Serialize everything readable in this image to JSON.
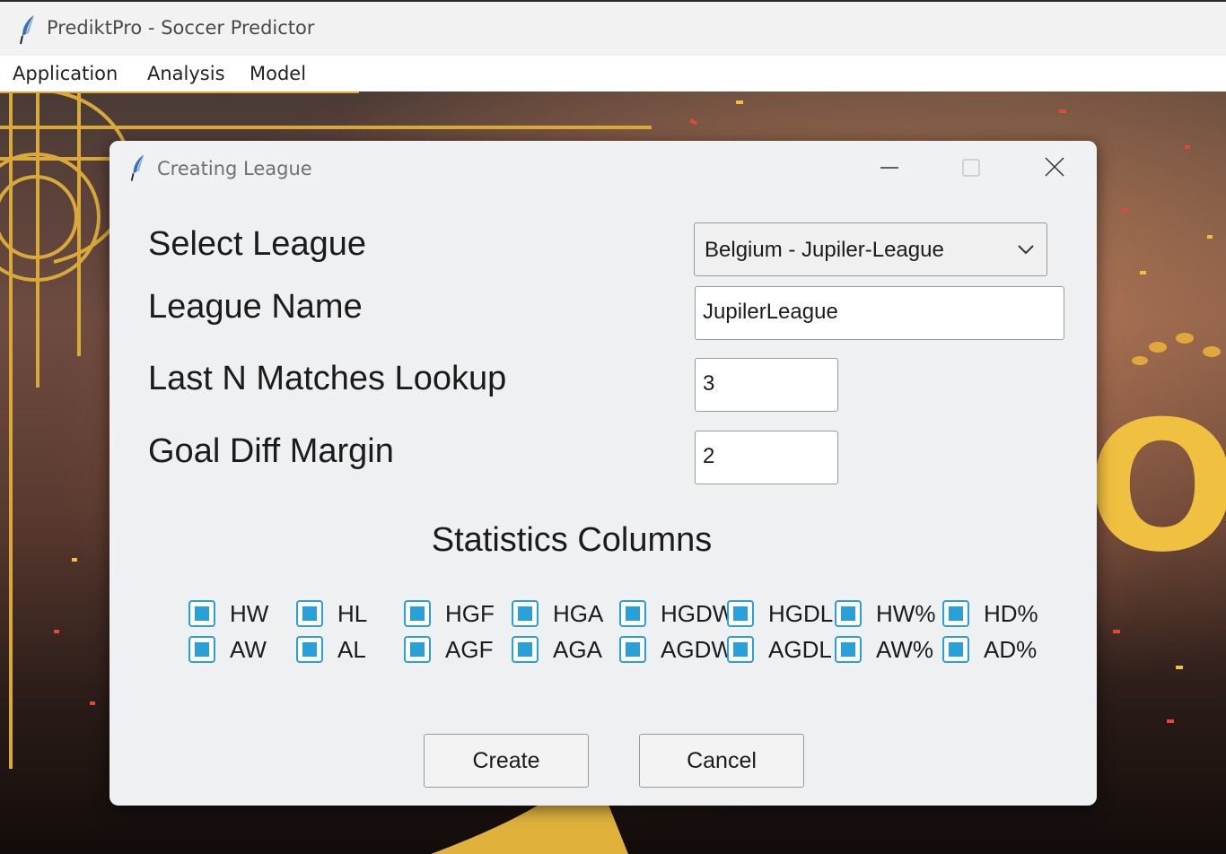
{
  "app": {
    "title": "PrediktPro - Soccer Predictor"
  },
  "menubar": [
    "Application",
    "Analysis",
    "Model"
  ],
  "dialog": {
    "title": "Creating League",
    "fields": {
      "select_league_label": "Select League",
      "select_league_value": "Belgium - Jupiler-League",
      "league_name_label": "League Name",
      "league_name_value": "JupilerLeague",
      "last_n_label": "Last N Matches Lookup",
      "last_n_value": "3",
      "goal_diff_label": "Goal Diff Margin",
      "goal_diff_value": "2"
    },
    "stats_title": "Statistics Columns",
    "stats_row1": [
      "HW",
      "HL",
      "HGF",
      "HGA",
      "HGDW",
      "HGDL",
      "HW%",
      "HD%"
    ],
    "stats_row2": [
      "AW",
      "AL",
      "AGF",
      "AGA",
      "AGDW",
      "AGDL",
      "AW%",
      "AD%"
    ],
    "checked": true,
    "buttons": {
      "create": "Create",
      "cancel": "Cancel"
    }
  },
  "colors": {
    "checkbox_accent": "#2a9fd8",
    "gold": "#d9a93a"
  }
}
